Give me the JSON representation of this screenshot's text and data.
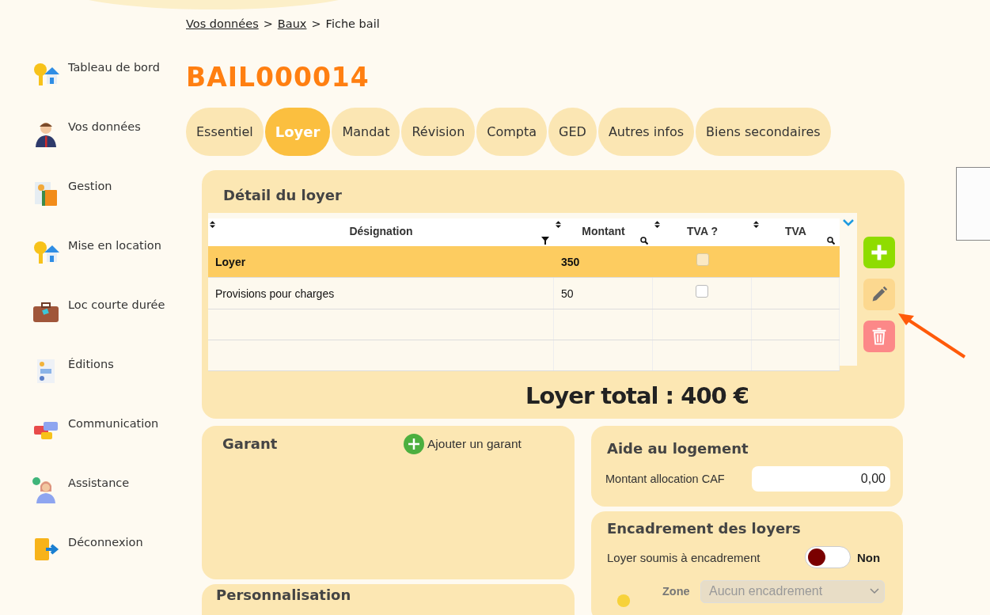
{
  "sidebar": {
    "items": [
      {
        "label": "Tableau de bord",
        "kind": "keys"
      },
      {
        "label": "Vos données",
        "kind": "person"
      },
      {
        "label": "Gestion",
        "kind": "calculator"
      },
      {
        "label": "Mise en location",
        "kind": "keys"
      },
      {
        "label": "Loc courte durée",
        "kind": "suitcase"
      },
      {
        "label": "Éditions",
        "kind": "report"
      },
      {
        "label": "Communication",
        "kind": "chat"
      },
      {
        "label": "Assistance",
        "kind": "support"
      },
      {
        "label": "Déconnexion",
        "kind": "exit"
      }
    ]
  },
  "breadcrumb": [
    {
      "label": "Vos données",
      "link": true
    },
    {
      "label": "Baux",
      "link": true
    },
    {
      "label": "Fiche bail",
      "link": false
    }
  ],
  "breadcrumb_separator": ">",
  "title": "BAIL000014",
  "tabs": [
    {
      "label": "Essentiel",
      "selected": false
    },
    {
      "label": "Loyer",
      "selected": true
    },
    {
      "label": "Mandat",
      "selected": false
    },
    {
      "label": "Révision",
      "selected": false
    },
    {
      "label": "Compta",
      "selected": false
    },
    {
      "label": "GED",
      "selected": false
    },
    {
      "label": "Autres infos",
      "selected": false
    },
    {
      "label": "Biens secondaires",
      "selected": false
    }
  ],
  "rent_detail": {
    "title": "Détail du loyer",
    "columns": [
      {
        "label": "Désignation",
        "kind": "filter"
      },
      {
        "label": "Montant",
        "kind": "search"
      },
      {
        "label": "TVA ?",
        "kind": "plain"
      },
      {
        "label": "TVA",
        "kind": "search"
      }
    ],
    "rows": [
      {
        "designation": "Loyer",
        "amount": "350",
        "vat_checked": false,
        "selected": true
      },
      {
        "designation": "Provisions pour charges",
        "amount": "50",
        "vat_checked": false,
        "selected": false
      }
    ],
    "total": "Loyer total : 400 €"
  },
  "guarantor": {
    "title": "Garant",
    "add_label": "Ajouter un garant"
  },
  "housing_aid": {
    "title": "Aide au logement",
    "field_label": "Montant allocation CAF",
    "value": "0,00"
  },
  "rent_control": {
    "title": "Encadrement des loyers",
    "toggle_label": "Loyer soumis à encadrement",
    "on": false,
    "state_label": "Non",
    "zone_label": "Zone",
    "zone_value": "Aucun encadrement",
    "zone_disabled": true
  },
  "customization": {
    "title": "Personnalisation"
  }
}
